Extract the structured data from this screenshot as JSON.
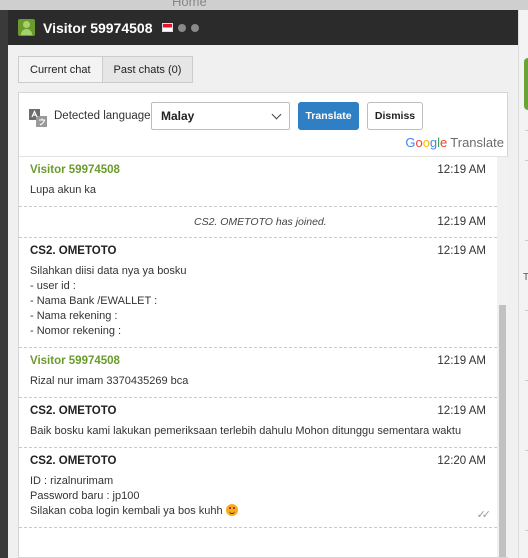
{
  "backdrop": {
    "home_text": "Home"
  },
  "window": {
    "title": "Visitor 59974508",
    "tabs": [
      {
        "label": "Current chat",
        "active": true
      },
      {
        "label": "Past chats (0)",
        "active": false
      }
    ]
  },
  "translate": {
    "detected_label": "Detected language",
    "selected_language": "Malay",
    "translate_button": "Translate",
    "dismiss_button": "Dismiss",
    "brand_google": [
      "G",
      "o",
      "o",
      "g",
      "l",
      "e"
    ],
    "brand_translate": "Translate"
  },
  "messages": [
    {
      "type": "visitor",
      "author": "Visitor 59974508",
      "time": "12:19 AM",
      "text": "Lupa akun ka"
    },
    {
      "type": "system",
      "text": "CS2. OMETOTO has joined.",
      "time": "12:19 AM"
    },
    {
      "type": "agent",
      "author": "CS2. OMETOTO",
      "time": "12:19 AM",
      "lines": [
        "Silahkan diisi data nya ya bosku",
        "- user id :",
        "- Nama Bank /EWALLET :",
        "- Nama rekening :",
        "- Nomor rekening :"
      ]
    },
    {
      "type": "visitor",
      "author": "Visitor 59974508",
      "time": "12:19 AM",
      "text": "Rizal nur imam 3370435269 bca"
    },
    {
      "type": "agent",
      "author": "CS2. OMETOTO",
      "time": "12:19 AM",
      "text": "Baik bosku kami lakukan pemeriksaan terlebih dahulu Mohon ditunggu sementara waktu"
    },
    {
      "type": "agent",
      "author": "CS2. OMETOTO",
      "time": "12:20 AM",
      "lines": [
        "ID : rizalnurimam",
        "Password baru : jp100",
        "Silakan coba login kembali ya bos kuhh"
      ]
    }
  ],
  "colors": {
    "visitor_name": "#6b9b2e",
    "translate_button": "#2f7fc5",
    "titlebar": "#2b2b2b"
  },
  "icons": [
    "avatar-icon",
    "flag-indonesia-icon",
    "device-icon",
    "browser-icon",
    "language-icon",
    "chevron-down-icon",
    "read-check-icon",
    "emoji-icon"
  ]
}
